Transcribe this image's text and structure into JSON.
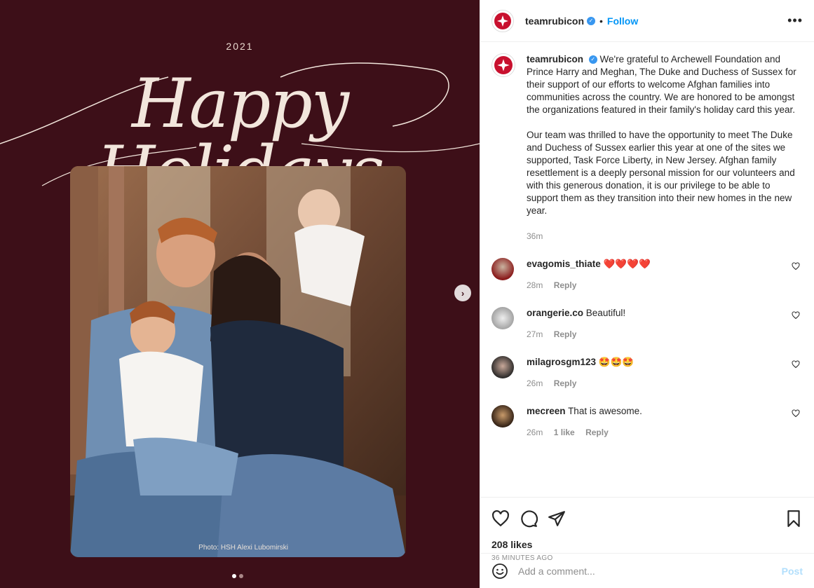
{
  "media": {
    "year": "2021",
    "script_title": "Happy Holidays",
    "photo_credit": "Photo: HSH Alexi Lubomirski",
    "next_icon": "chevron-right-icon",
    "slides_total": 2,
    "slide_active": 1
  },
  "header": {
    "username": "teamrubicon",
    "follow_label": "Follow",
    "separator": "•",
    "more_label": "•••"
  },
  "caption": {
    "username": "teamrubicon",
    "paragraph1": "We're grateful to Archewell Foundation and Prince Harry and Meghan, The Duke and Duchess of Sussex for their support of our efforts to welcome Afghan families into communities across the country. We are honored to be amongst the organizations featured in their family's holiday card this year.",
    "paragraph2": "Our team was thrilled to have the opportunity to meet The Duke and Duchess of Sussex earlier this year at one of the sites we supported, Task Force Liberty, in New Jersey. Afghan family resettlement is a deeply personal mission for our volunteers and with this generous donation, it is our privilege to be able to support them as they transition into their new homes in the new year.",
    "time": "36m"
  },
  "comments": [
    {
      "user": "evagomis_thiate",
      "text": "❤️❤️❤️❤️",
      "time": "28m",
      "likes": "",
      "reply": "Reply"
    },
    {
      "user": "orangerie.co",
      "text": "Beautiful!",
      "time": "27m",
      "likes": "",
      "reply": "Reply"
    },
    {
      "user": "milagrosgm123",
      "text": "🤩🤩🤩",
      "time": "26m",
      "likes": "",
      "reply": "Reply"
    },
    {
      "user": "mecreen",
      "text": "That is awesome.",
      "time": "26m",
      "likes": "1 like",
      "reply": "Reply"
    }
  ],
  "stats": {
    "likes": "208 likes",
    "ago": "36 MINUTES AGO"
  },
  "add_comment": {
    "placeholder": "Add a comment...",
    "post_label": "Post"
  },
  "colors": {
    "media_bg": "#3d0f18",
    "follow": "#0095f6",
    "brand_red": "#c8102e"
  }
}
